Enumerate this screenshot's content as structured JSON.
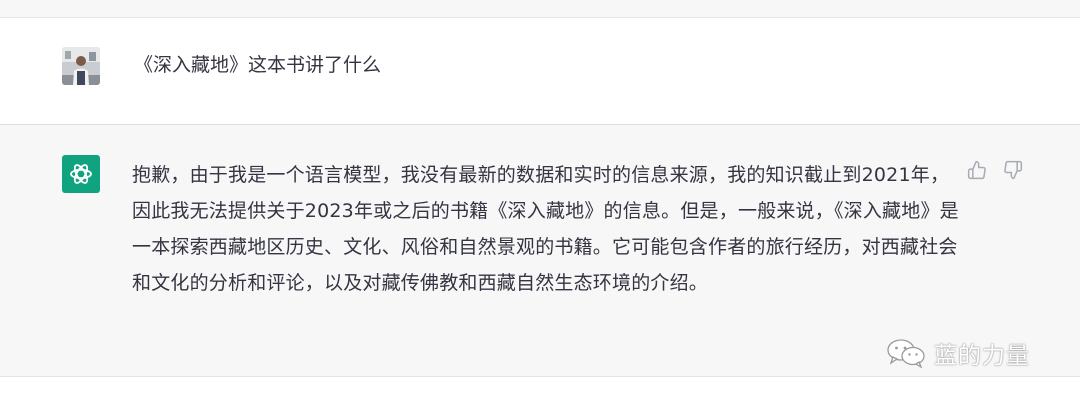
{
  "user_message": {
    "text": "《深入藏地》这本书讲了什么"
  },
  "assistant_message": {
    "text": "抱歉，由于我是一个语言模型，我没有最新的数据和实时的信息来源，我的知识截止到2021年，因此我无法提供关于2023年或之后的书籍《深入藏地》的信息。但是，一般来说，《深入藏地》是一本探索西藏地区历史、文化、风俗和自然景观的书籍。它可能包含作者的旅行经历，对西藏社会和文化的分析和评论，以及对藏传佛教和西藏自然生态环境的介绍。"
  },
  "feedback_icons": [
    "thumbs-up-icon",
    "thumbs-down-icon"
  ],
  "watermark": {
    "text": "蓝的力量"
  },
  "colors": {
    "bot_avatar_bg": "#10a37f",
    "assistant_bg": "#f7f7f8",
    "text": "#343541"
  }
}
